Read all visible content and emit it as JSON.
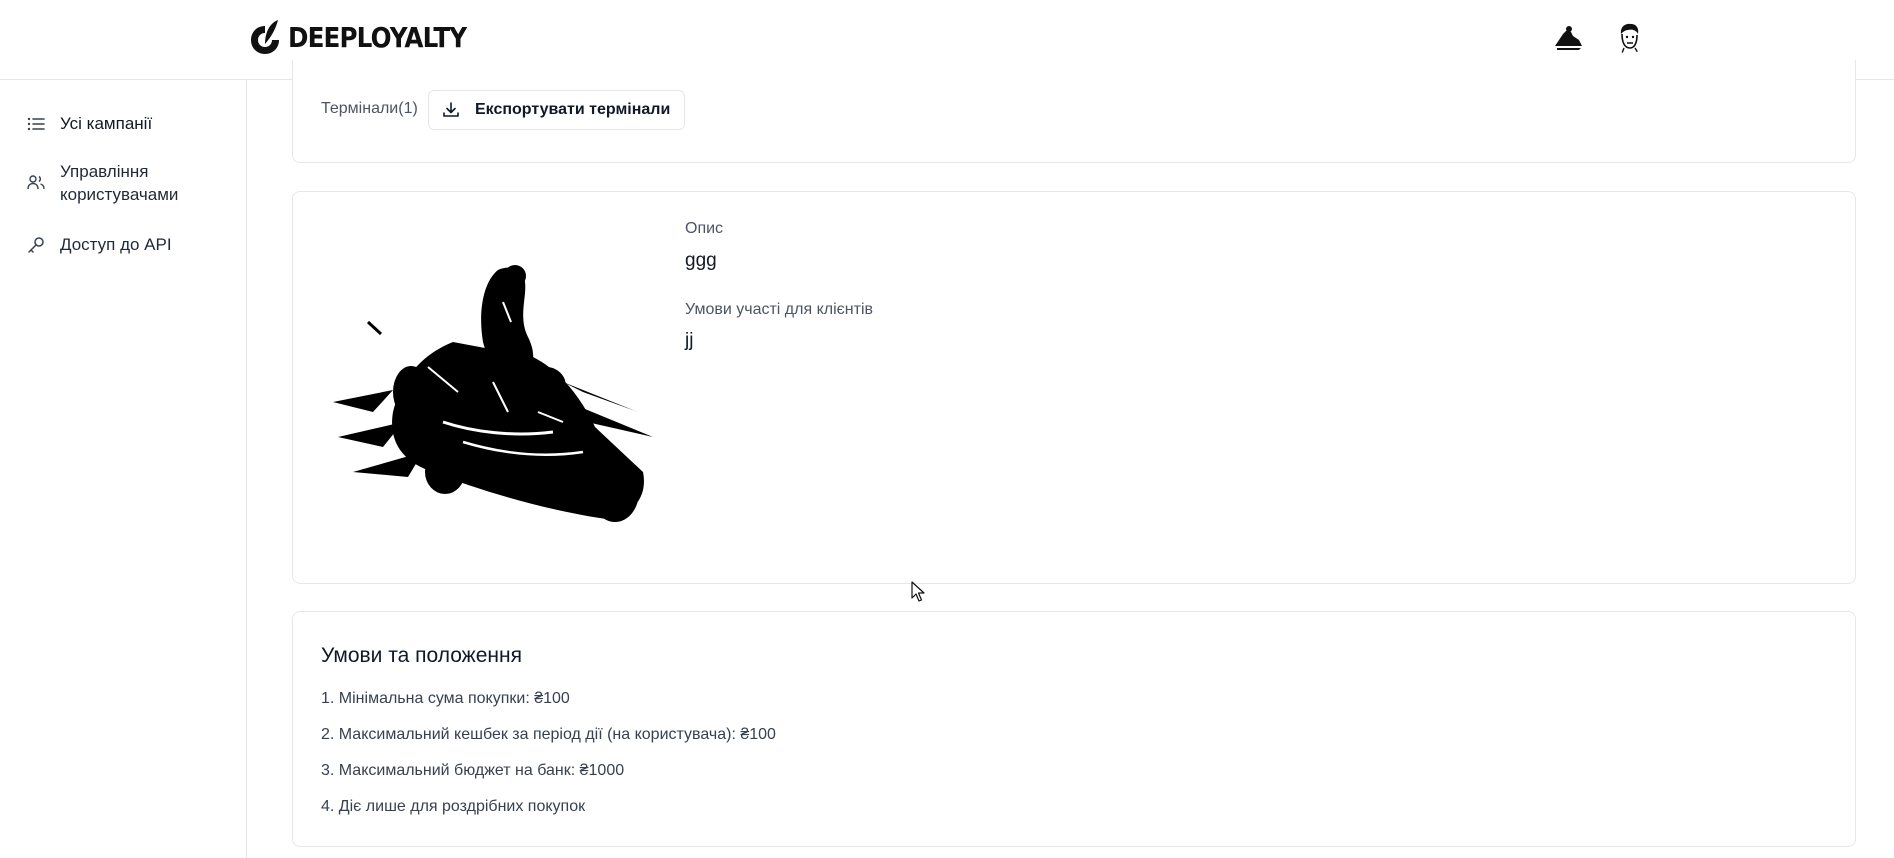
{
  "header": {
    "logo_text": "DEEPLOYALTY"
  },
  "sidebar": {
    "items": [
      {
        "label": "Усі кампанії",
        "icon": "list-icon"
      },
      {
        "label": "Управління користувачами",
        "icon": "users-icon"
      },
      {
        "label": "Доступ до API",
        "icon": "key-icon"
      }
    ]
  },
  "terminals": {
    "label": "Термінали(1)",
    "export_button": "Експортувати термінали"
  },
  "description": {
    "desc_label": "Опис",
    "desc_value": "ggg",
    "conditions_label": "Умови участі для клієнтів",
    "conditions_value": "jj"
  },
  "terms": {
    "title": "Умови та положення",
    "items": [
      "1. Мінімальна сума покупки: ₴100",
      "2. Максимальний кешбек за період дії (на користувача): ₴100",
      "3. Максимальний бюджет на банк: ₴1000",
      "4. Діє лише для роздрібних покупок"
    ]
  }
}
